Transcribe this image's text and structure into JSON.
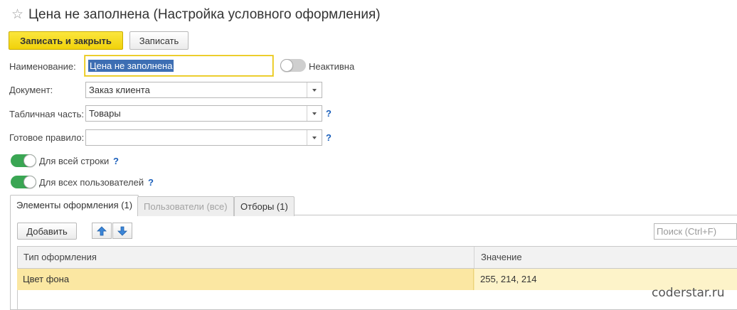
{
  "header": {
    "favorite_icon": "star-icon",
    "title": "Цена не заполнена (Настройка условного оформления)"
  },
  "toolbar": {
    "save_close_label": "Записать и закрыть",
    "save_label": "Записать"
  },
  "form": {
    "name_label": "Наименование:",
    "name_value": "Цена не заполнена",
    "inactive_label": "Неактивна",
    "inactive_on": false,
    "document_label": "Документ:",
    "document_value": "Заказ клиента",
    "table_part_label": "Табличная часть:",
    "table_part_value": "Товары",
    "ready_rule_label": "Готовое правило:",
    "ready_rule_value": "",
    "help_mark": "?",
    "whole_row_label": "Для всей строки",
    "whole_row_on": true,
    "all_users_label": "Для всех пользователей",
    "all_users_on": true
  },
  "tabs": [
    {
      "label": "Элементы оформления (1)",
      "active": true,
      "disabled": false
    },
    {
      "label": "Пользователи (все)",
      "active": false,
      "disabled": true
    },
    {
      "label": "Отборы (1)",
      "active": false,
      "disabled": false
    }
  ],
  "panel": {
    "add_label": "Добавить",
    "up_icon": "arrow-up-icon",
    "down_icon": "arrow-down-icon",
    "search_placeholder": "Поиск (Ctrl+F)"
  },
  "grid": {
    "columns": [
      "Тип оформления",
      "Значение"
    ],
    "rows": [
      {
        "type": "Цвет фона",
        "value": "255, 214, 214"
      }
    ]
  },
  "watermark": "coderstar.ru",
  "colors": {
    "accent_yellow": "#f4d81e",
    "toggle_on": "#3aa653",
    "selected_row": "#fbe7a2",
    "help_blue": "#1a5fbb"
  }
}
